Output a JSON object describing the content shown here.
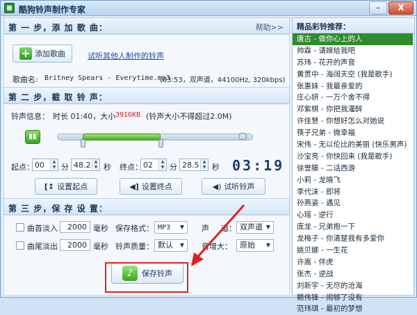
{
  "window": {
    "title": "酷狗铃声制作专家",
    "buttons": {
      "minimize": "–",
      "close": "X"
    }
  },
  "step1": {
    "title": "第 一 步，添 加 歌 曲：",
    "help": "帮助>>",
    "add_song": "添加歌曲",
    "try_link": "试听其他人制作的铃声",
    "song_label": "歌曲名:",
    "song_info": "Britney Spears - Everytime.mp3",
    "song_meta": "(03:53，双声道，44100Hz, 320kbps)"
  },
  "step2": {
    "title": "第 二 步，截 取 铃 声：",
    "info_label": "铃声信息：",
    "duration": "时长 01:40，大小",
    "size": "3916KB",
    "limit": "(铃声大小不得超过2.0M)",
    "play_icon": "play-pause-icon",
    "selection_start_fraction": 0.13,
    "selection_end_fraction": 0.53,
    "start_label": "起点：",
    "start_min": "00",
    "start_sec": "48.2",
    "end_label": "终点：",
    "end_min": "02",
    "end_sec": "28.5",
    "unit_min": "分",
    "unit_sec": "秒",
    "clock": "03:19",
    "set_start": "设置起点",
    "set_end": "设置终点",
    "preview": "试听铃声"
  },
  "step3": {
    "title": "第 三 步，保 存 设 置：",
    "fade_in": "曲首淡入",
    "fade_in_value": "2000",
    "fade_out": "曲尾淡出",
    "fade_out_value": "2000",
    "ms": "毫秒",
    "format_label": "保存格式：",
    "format": "MP3",
    "quality_label": "铃声质量：",
    "quality": "默认",
    "channel_label_a": "声",
    "channel_label_b": "道：",
    "channel": "双声道",
    "gain_label": "音增大：",
    "gain": "原始",
    "save": "保存铃声"
  },
  "recommend": {
    "title": "精品彩铃推荐：",
    "items": [
      "唐古 - 做你心上的人",
      "帅霖 - 请嫁给我吧",
      "苏玮 - 花开的声音",
      "黄贯中 - 海阔天空 (我是歌手)",
      "张惠妹 - 我最亲爱的",
      "庄心妍 - 一万个舍不得",
      "邓紫棋 - 你把我灌醉",
      "许佳慧 - 你想好怎么对她说",
      "筷子兄弟 - 微幸福",
      "宋伟 - 无以伦比的美丽 (快乐男声)",
      "沙宝亮 - 你快回来 (我是歌手)",
      "徐誉滕 - 二话西游",
      "小莉 - 龙晓飞",
      "李代沫 - 即将",
      "孙燕姿 - 遇见",
      "心瑶 - 逆行",
      "庞龙 - 兄弟抱一下",
      "龙梅子 - 你清楚我有多爱你",
      "姚贝娜 - 一生花",
      "许嵩 - 伴虎",
      "张杰 - 逆战",
      "刘新宇 - 无尽的沧海",
      "赖伟锋 - 闹够了没有",
      "范玮琪 - 最初的梦想"
    ]
  },
  "colors": {
    "accent": "#2e8b2e",
    "highlight_box": "#e02020",
    "size_text": "#d01e1e"
  }
}
